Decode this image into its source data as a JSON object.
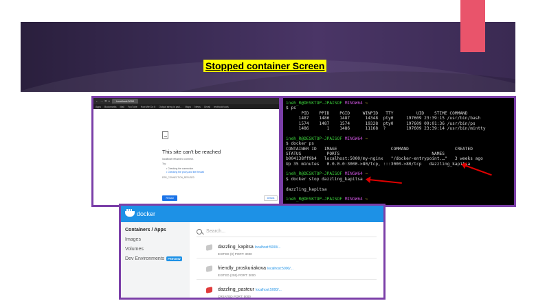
{
  "slide": {
    "title": "Stopped container Screen"
  },
  "colors": {
    "band": "#3b2c55",
    "accent": "#e9546b",
    "title_highlight": "#ffff00",
    "panel_border": "#7b3fa8",
    "docker_blue": "#1d91e6",
    "arrow_red": "#e00000"
  },
  "browser": {
    "nav_glyphs": "← → ✕ ⌂",
    "url": "localhost:3000",
    "bookmarks": [
      "Apps",
      "Bookmarks",
      "Mail",
      "YouTube",
      "How We Do It",
      "Output string is pad...",
      "Maps",
      "News",
      "Gmail",
      "resthook tools"
    ],
    "error_title": "This site can't be reached",
    "error_detail": "localhost refused to connect.",
    "try_label": "Try:",
    "suggestions": [
      "Checking the connection",
      "Checking the proxy and the firewall"
    ],
    "error_code": "ERR_CONNECTION_REFUSED",
    "reload_label": "Reload",
    "details_label": "Details"
  },
  "terminal": {
    "prompt_user": "ineh_R@DESKTOP-JPAISOF",
    "prompt_env": "MINGW64",
    "prompt_path": "~",
    "lines": [
      "$ ps",
      "      PID    PPID    PGID     WINPID   TTY         UID    STIME COMMAND",
      "     1487    1486    1487      14348  pty0     197609 23:39:15 /usr/bin/bash",
      "     1574    1487    1574      19328  pty0     197609 09:01:36 /usr/bin/ps",
      "     1486       1    1486      11168  ?        197609 23:39:14 /usr/bin/mintty",
      "",
      "$ docker ps",
      "CONTAINER ID   IMAGE                     COMMAND                  CREATED",
      "STATUS          PORTS                                    NAMES",
      "b004138ff9b4   localhost:5000/my-nginx   \"/docker-entrypoint.…\"   3 weeks ago",
      "Up 35 minutes   0.0.0.0:3000->80/tcp, :::3000->80/tcp   dazzling_kapitsa",
      "",
      "$ docker stop dazzling_kapitsa",
      "dazzling_kapitsa",
      ""
    ]
  },
  "docker": {
    "brand": "docker",
    "nav": [
      {
        "label": "Containers / Apps",
        "active": true,
        "badge": ""
      },
      {
        "label": "Images",
        "active": false,
        "badge": ""
      },
      {
        "label": "Volumes",
        "active": false,
        "badge": ""
      },
      {
        "label": "Dev Environments",
        "active": false,
        "badge": "PREVIEW"
      }
    ],
    "search_placeholder": "Search...",
    "containers": [
      {
        "name": "dazzling_kapitsa",
        "link": "localhost:5000/...",
        "status": "EXITED (0)   PORT: 3000",
        "icon": "container-stopped-icon"
      },
      {
        "name": "friendly_proskuriakova",
        "link": "localhost:5000/...",
        "status": "EXITED (255)   PORT: 3000",
        "icon": "container-stopped-icon"
      },
      {
        "name": "dazzling_pasteur",
        "link": "localhost:5000/...",
        "status": "CREATED   PORT: 5000",
        "icon": "container-created-icon"
      }
    ]
  }
}
